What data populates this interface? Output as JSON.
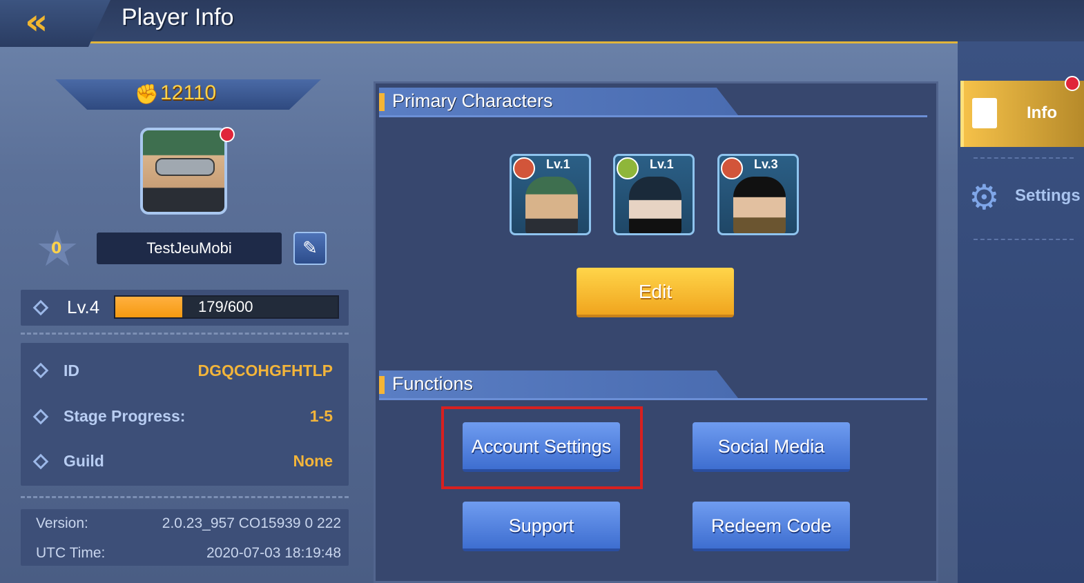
{
  "header": {
    "title": "Player Info",
    "back_icon": "double-chevron-left-icon"
  },
  "player": {
    "power": "12110",
    "rank": "0",
    "name": "TestJeuMobi",
    "level": "Lv.4",
    "xp_text": "179/600",
    "xp_progress": 0.3,
    "id_label": "ID",
    "id_value": "DGQCOHGFHTLP",
    "stage_label": "Stage Progress:",
    "stage_value": "1-5",
    "guild_label": "Guild",
    "guild_value": "None"
  },
  "meta": {
    "version_label": "Version:",
    "version_value": "2.0.23_957 CO15939 0 222",
    "utc_label": "UTC Time:",
    "utc_value": "2020-07-03 18:19:48"
  },
  "primary": {
    "title": "Primary Characters",
    "characters": [
      {
        "level": "Lv.1",
        "type_color": "#d2553a"
      },
      {
        "level": "Lv.1",
        "type_color": "#8fb63a"
      },
      {
        "level": "Lv.3",
        "type_color": "#d2553a"
      }
    ],
    "edit_label": "Edit"
  },
  "functions": {
    "title": "Functions",
    "account_settings": "Account Settings",
    "social_media": "Social Media",
    "support": "Support",
    "redeem_code": "Redeem Code"
  },
  "sidebar": {
    "info_label": "Info",
    "settings_label": "Settings"
  },
  "colors": {
    "accent_gold": "#f5b536",
    "highlight_red": "#d8201f",
    "value_orange": "#f3b53a"
  }
}
